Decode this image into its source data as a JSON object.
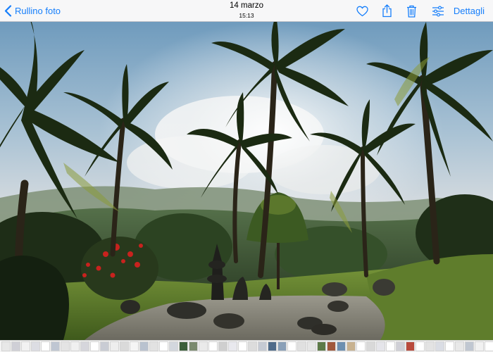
{
  "navbar": {
    "back_label": "Rullino foto",
    "date": "14 marzo",
    "time": "15:13",
    "details_label": "Dettagli",
    "accent_color": "#157efb",
    "icons": [
      "chevron-left-icon",
      "heart-icon",
      "share-icon",
      "trash-icon",
      "adjust-icon"
    ]
  },
  "photo": {
    "description_icon": "photo"
  },
  "thumbnails": {
    "colors": [
      "#e8e8e8",
      "#cfcfd6",
      "#f2f2f2",
      "#dcdde3",
      "#ffffff",
      "#bfc6d2",
      "#e4e4e4",
      "#f0f0f0",
      "#d6d6dc",
      "#ffffff",
      "#c9ccd4",
      "#eeeeee",
      "#dadada",
      "#f5f5f5",
      "#b9c2cf",
      "#e2e2e2",
      "#ffffff",
      "#d3d7de",
      "#3c5f3a",
      "#7a8a6e",
      "#eaeaea",
      "#ffffff",
      "#cfcfcf",
      "#e9e9ee",
      "#ffffff",
      "#dcdcdc",
      "#c5cad3",
      "#4f6b8a",
      "#8aa0b8",
      "#ffffff",
      "#e0e0e0",
      "#e6e6e6",
      "#5d7a48",
      "#a0583c",
      "#6d8fb0",
      "#c8b290",
      "#ffffff",
      "#d9d9d9",
      "#e5e5ea",
      "#ffffff",
      "#cfcfd6",
      "#b94a3c",
      "#ffffff",
      "#e3e3e3",
      "#dadde4",
      "#ffffff",
      "#e8e8e8",
      "#c0c7d1",
      "#f1f1f1",
      "#ffffff",
      "#d8d8d8",
      "#7c6a55",
      "#e0e0e6",
      "#ffffff",
      "#d0d4db",
      "#eaeaea"
    ]
  }
}
